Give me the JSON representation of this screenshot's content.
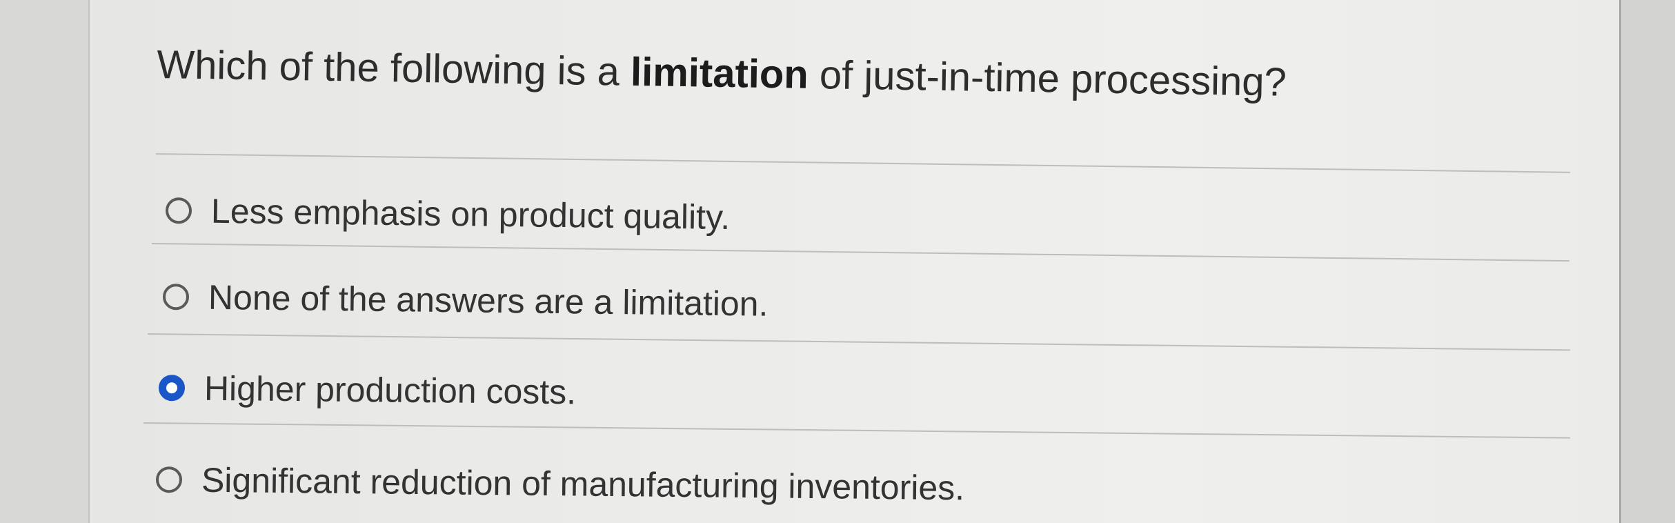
{
  "question": {
    "prefix": "Which of the following is a ",
    "keyword": "limitation",
    "suffix": " of just-in-time processing?"
  },
  "options": [
    {
      "label": "Less emphasis on product quality.",
      "selected": false
    },
    {
      "label": "None of the answers are a limitation.",
      "selected": false
    },
    {
      "label": "Higher production costs.",
      "selected": true
    },
    {
      "label": "Significant reduction of manufacturing inventories.",
      "selected": false
    }
  ],
  "colors": {
    "selected_radio": "#1a56c8",
    "text": "#333333",
    "background": "#ececea"
  }
}
